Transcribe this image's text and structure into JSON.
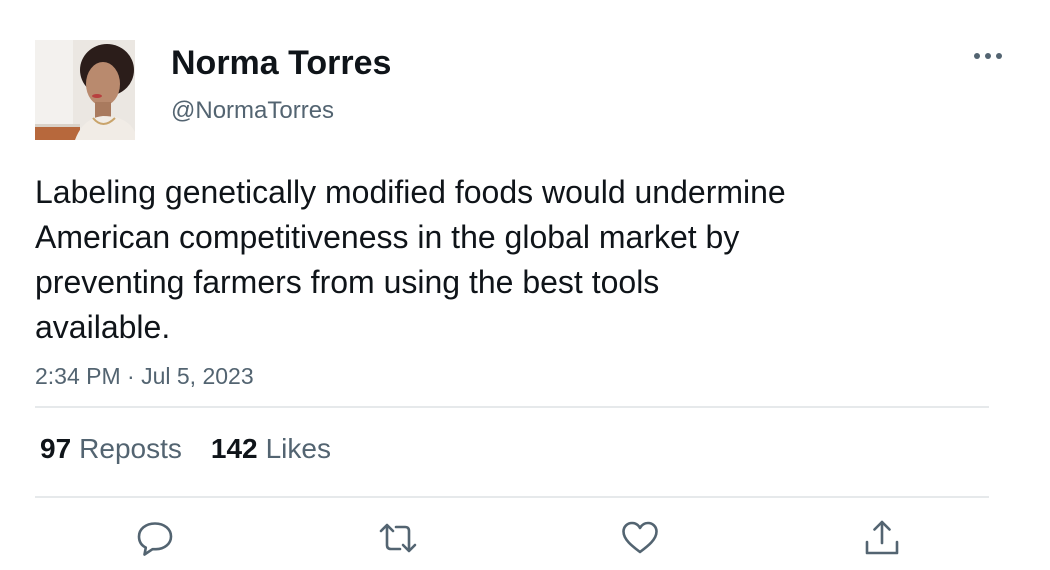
{
  "author": {
    "display_name": "Norma Torres",
    "handle": "@NormaTorres",
    "avatar_icon": "profile-photo"
  },
  "tweet": {
    "text": "Labeling genetically modified foods would undermine\nAmerican competitiveness in the global market by\npreventing farmers from using the best tools\navailable.",
    "timestamp": "2:34 PM · Jul 5, 2023"
  },
  "stats": {
    "reposts_count": "97",
    "reposts_label": "Reposts",
    "likes_count": "142",
    "likes_label": "Likes"
  },
  "actions": [
    {
      "name": "reply",
      "icon": "speech-bubble-icon"
    },
    {
      "name": "repost",
      "icon": "repost-arrows-icon"
    },
    {
      "name": "like",
      "icon": "heart-icon"
    },
    {
      "name": "share",
      "icon": "share-upload-icon"
    }
  ],
  "menu": {
    "icon": "more-dots-icon"
  },
  "colors": {
    "text_primary": "#0f1419",
    "text_secondary": "#536471",
    "divider": "#e6e9eb",
    "icon": "#536471"
  }
}
